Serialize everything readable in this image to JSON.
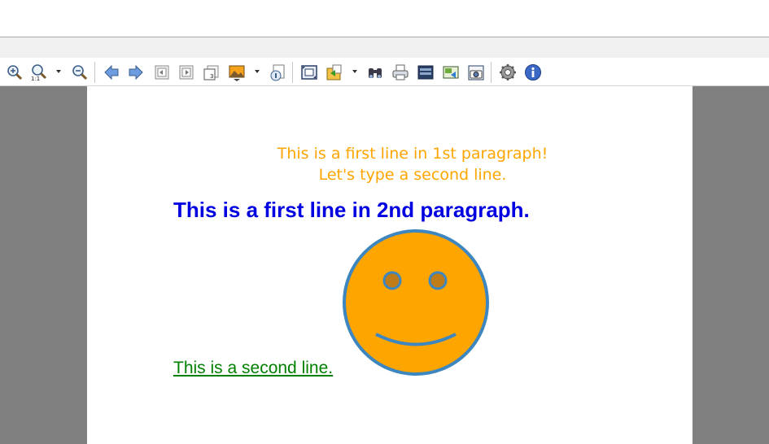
{
  "toolbar": {
    "buttons": [
      {
        "name": "zoom-in-icon"
      },
      {
        "name": "zoom-actual-size-icon"
      },
      {
        "name": "zoom-out-icon"
      },
      {
        "name": "back-arrow-icon"
      },
      {
        "name": "forward-arrow-icon"
      },
      {
        "name": "first-page-icon"
      },
      {
        "name": "next-page-icon"
      },
      {
        "name": "page-number-icon"
      },
      {
        "name": "background-image-icon"
      },
      {
        "name": "page-setup-icon"
      },
      {
        "name": "fit-page-icon"
      },
      {
        "name": "export-icon"
      },
      {
        "name": "find-binoculars-icon"
      },
      {
        "name": "print-icon"
      },
      {
        "name": "save-layers-icon"
      },
      {
        "name": "send-image-icon"
      },
      {
        "name": "snapshot-camera-icon"
      },
      {
        "name": "settings-gear-icon"
      },
      {
        "name": "info-icon"
      }
    ]
  },
  "document": {
    "paragraph1_line1": "This is a first line in 1st paragraph!",
    "paragraph1_line2": "Let's type a second line.",
    "paragraph2_line1": "This is a first line in 2nd paragraph.",
    "paragraph2_line2": "This is a second line."
  },
  "colors": {
    "orange_text": "#ffa500",
    "blue_text": "#0000e0",
    "green_text": "#008000",
    "smiley_fill": "#ffa500",
    "smiley_stroke": "#3d86bf",
    "viewer_bg": "#808080"
  }
}
